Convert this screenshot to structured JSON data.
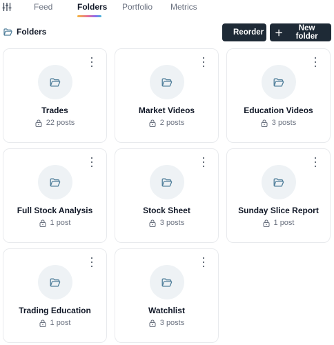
{
  "tabs": [
    {
      "label": "Feed",
      "active": false
    },
    {
      "label": "Folders",
      "active": true
    },
    {
      "label": "Portfolio",
      "active": false
    },
    {
      "label": "Metrics",
      "active": false
    }
  ],
  "section": {
    "title": "Folders",
    "reorder_label": "Reorder",
    "new_folder_label": "New folder"
  },
  "folders": [
    {
      "name": "Trades",
      "posts": "22 posts"
    },
    {
      "name": "Market Videos",
      "posts": "2 posts"
    },
    {
      "name": "Education Videos",
      "posts": "3 posts"
    },
    {
      "name": "Full Stock Analysis",
      "posts": "1 post"
    },
    {
      "name": "Stock Sheet",
      "posts": "3 posts"
    },
    {
      "name": "Sunday Slice Report",
      "posts": "1 post"
    },
    {
      "name": "Trading Education",
      "posts": "1 post"
    },
    {
      "name": "Watchlist",
      "posts": "3 posts"
    }
  ],
  "colors": {
    "button_bg": "#1e2a36",
    "folder_icon": "#4e7d99",
    "avatar_bg": "#eef2f5",
    "card_border": "#e8eaed"
  }
}
